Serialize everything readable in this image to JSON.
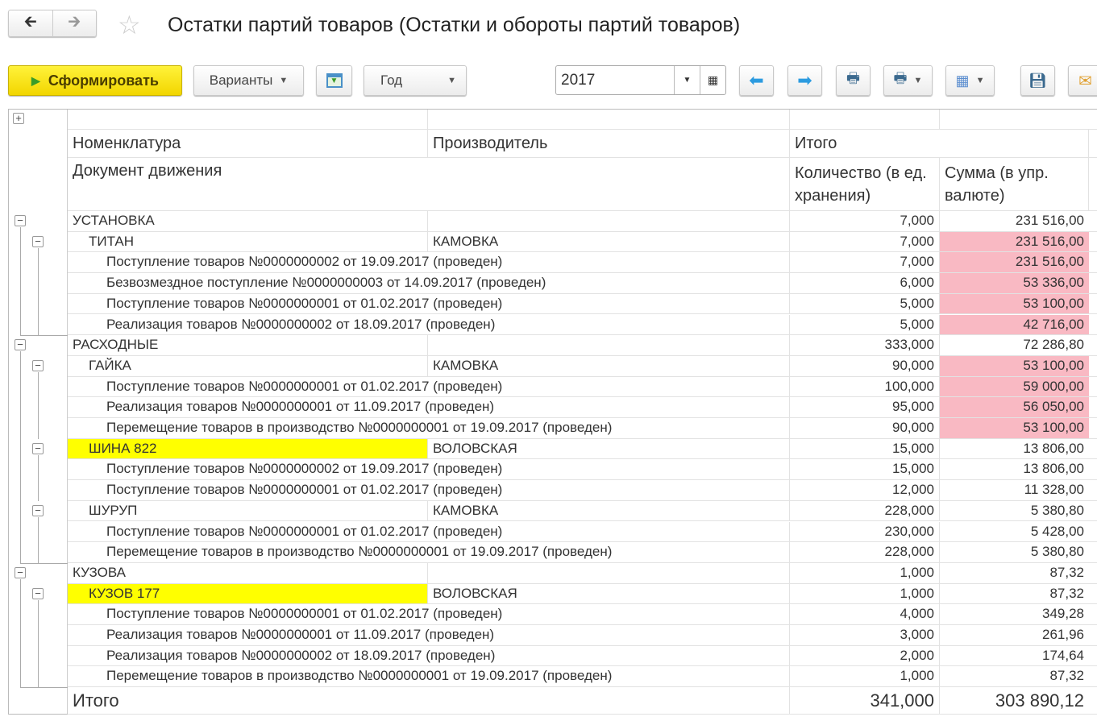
{
  "window": {
    "title": "Остатки партий товаров (Остатки и обороты партий товаров)",
    "back_icon": "arrow-left",
    "forward_icon": "arrow-right",
    "favorite_icon": "star"
  },
  "toolbar": {
    "generate": "Сформировать",
    "variants": "Варианты",
    "period_type": "Год",
    "period_value": "2017"
  },
  "colors": {
    "highlight_pink": "#f9b9c3",
    "highlight_yellow": "#ffff00",
    "generate_button": "#f5dc10"
  },
  "table": {
    "headers": {
      "nomenclature": "Номенклатура",
      "manufacturer": "Производитель",
      "total": "Итого",
      "document": "Документ движения",
      "quantity": "Количество (в ед. хранения)",
      "sum": "Сумма (в упр. валюте)"
    },
    "rows": [
      {
        "level": 0,
        "name": "УСТАНОВКА",
        "maker": "",
        "qty": "7,000",
        "sum": "231 516,00"
      },
      {
        "level": 1,
        "name": "ТИТАН",
        "maker": "КАМОВКА",
        "qty": "7,000",
        "sum": "231 516,00",
        "pink": true
      },
      {
        "level": 2,
        "name": "Поступление товаров №0000000002 от 19.09.2017 (проведен)",
        "qty": "7,000",
        "sum": "231 516,00",
        "pink": true
      },
      {
        "level": 2,
        "name": "Безвозмездное поступление №0000000003 от 14.09.2017 (проведен)",
        "qty": "6,000",
        "sum": "53 336,00",
        "pink": true
      },
      {
        "level": 2,
        "name": "Поступление товаров №0000000001 от 01.02.2017 (проведен)",
        "qty": "5,000",
        "sum": "53 100,00",
        "pink": true
      },
      {
        "level": 2,
        "name": "Реализация товаров №0000000002 от 18.09.2017 (проведен)",
        "qty": "5,000",
        "sum": "42 716,00",
        "pink": true
      },
      {
        "level": 0,
        "name": "РАСХОДНЫЕ",
        "maker": "",
        "qty": "333,000",
        "sum": "72 286,80"
      },
      {
        "level": 1,
        "name": "ГАЙКА",
        "maker": "КАМОВКА",
        "qty": "90,000",
        "sum": "53 100,00",
        "pink": true
      },
      {
        "level": 2,
        "name": "Поступление товаров №0000000001 от 01.02.2017 (проведен)",
        "qty": "100,000",
        "sum": "59 000,00",
        "pink": true
      },
      {
        "level": 2,
        "name": "Реализация товаров №0000000001 от 11.09.2017 (проведен)",
        "qty": "95,000",
        "sum": "56 050,00",
        "pink": true
      },
      {
        "level": 2,
        "name": "Перемещение товаров в производство №0000000001 от 19.09.2017 (проведен)",
        "qty": "90,000",
        "sum": "53 100,00",
        "pink": true
      },
      {
        "level": 1,
        "name": "ШИНА 822",
        "maker": "ВОЛОВСКАЯ",
        "qty": "15,000",
        "sum": "13 806,00",
        "yellow": true
      },
      {
        "level": 2,
        "name": "Поступление товаров №0000000002 от 19.09.2017 (проведен)",
        "qty": "15,000",
        "sum": "13 806,00"
      },
      {
        "level": 2,
        "name": "Поступление товаров №0000000001 от 01.02.2017 (проведен)",
        "qty": "12,000",
        "sum": "11 328,00"
      },
      {
        "level": 1,
        "name": "ШУРУП",
        "maker": "КАМОВКА",
        "qty": "228,000",
        "sum": "5 380,80"
      },
      {
        "level": 2,
        "name": "Поступление товаров №0000000001 от 01.02.2017 (проведен)",
        "qty": "230,000",
        "sum": "5 428,00"
      },
      {
        "level": 2,
        "name": "Перемещение товаров в производство №0000000001 от 19.09.2017 (проведен)",
        "qty": "228,000",
        "sum": "5 380,80"
      },
      {
        "level": 0,
        "name": "КУЗОВА",
        "maker": "",
        "qty": "1,000",
        "sum": "87,32"
      },
      {
        "level": 1,
        "name": "КУЗОВ 177",
        "maker": "ВОЛОВСКАЯ",
        "qty": "1,000",
        "sum": "87,32",
        "yellow": true
      },
      {
        "level": 2,
        "name": "Поступление товаров №0000000001 от 01.02.2017 (проведен)",
        "qty": "4,000",
        "sum": "349,28"
      },
      {
        "level": 2,
        "name": "Реализация товаров №0000000001 от 11.09.2017 (проведен)",
        "qty": "3,000",
        "sum": "261,96"
      },
      {
        "level": 2,
        "name": "Реализация товаров №0000000002 от 18.09.2017 (проведен)",
        "qty": "2,000",
        "sum": "174,64"
      },
      {
        "level": 2,
        "name": "Перемещение товаров в производство №0000000001 от 19.09.2017 (проведен)",
        "qty": "1,000",
        "sum": "87,32"
      }
    ],
    "total": {
      "label": "Итого",
      "qty": "341,000",
      "sum": "303 890,12"
    }
  }
}
